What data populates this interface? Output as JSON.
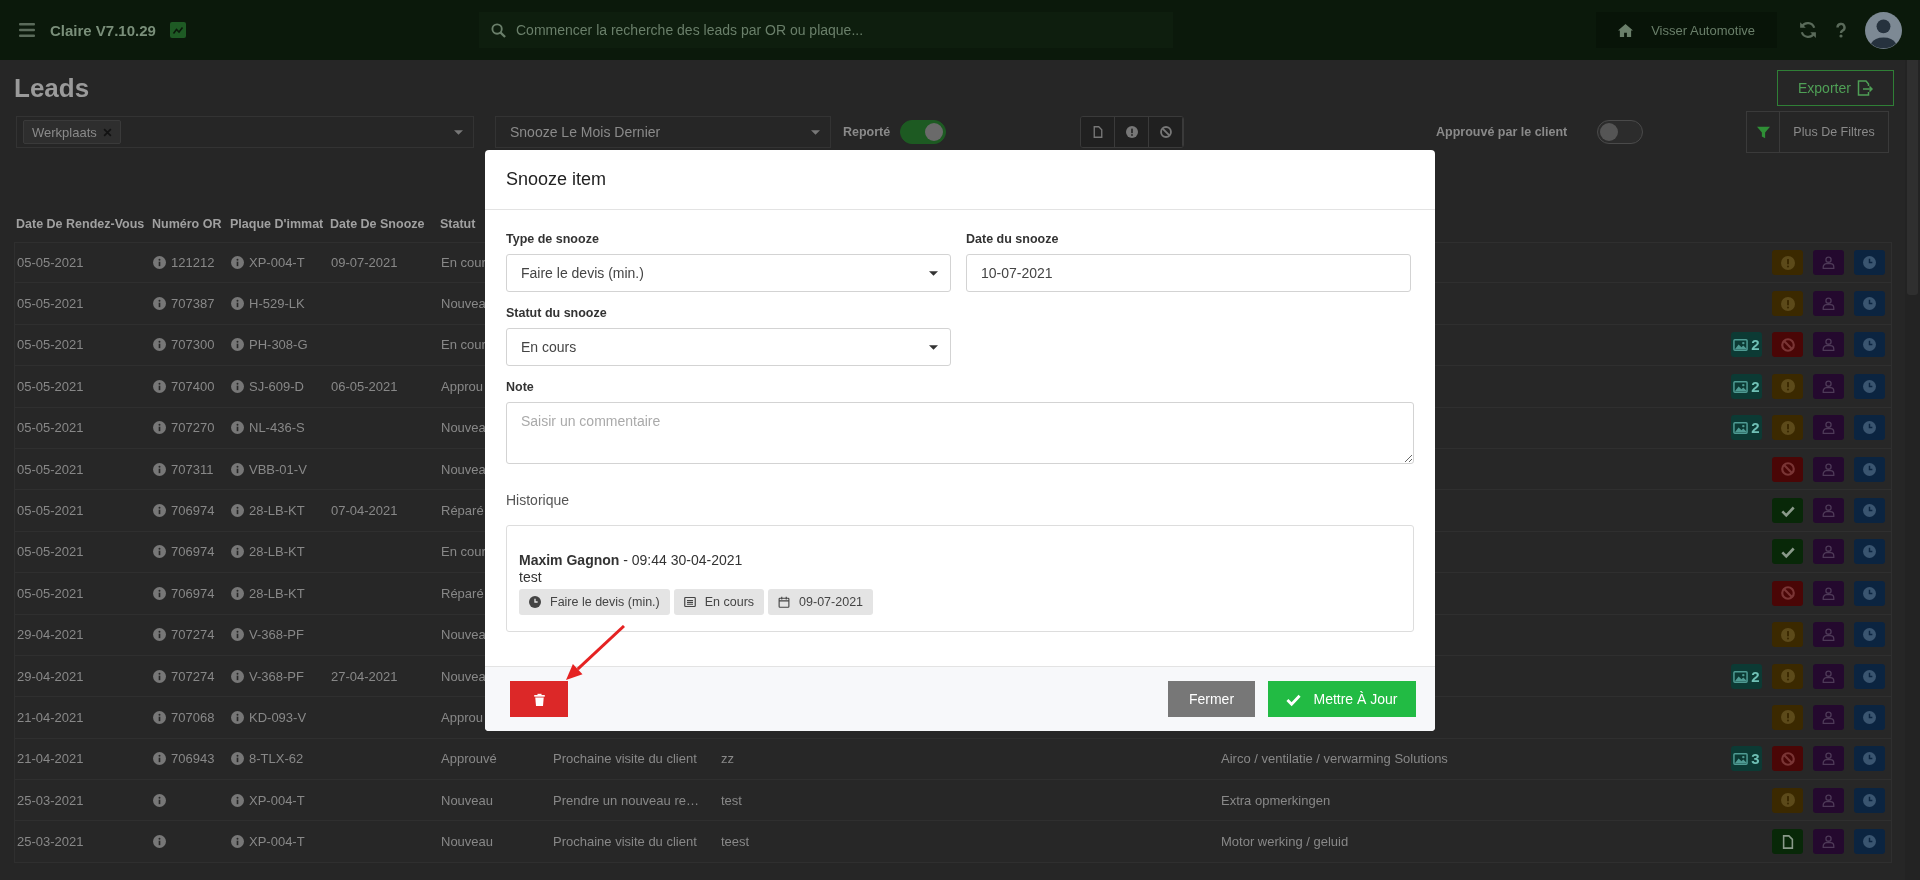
{
  "topbar": {
    "app_name": "Claire V7.10.29",
    "search": {
      "placeholder": "Commencer la recherche des leads par OR ou plaque..."
    },
    "garage_button": "Visser Automotive"
  },
  "page_title": "Leads",
  "export_button": "Exporter",
  "filters": {
    "tags": [
      {
        "label": "Werkplaats"
      }
    ],
    "period": "Snooze Le Mois Dernier",
    "reported": {
      "label": "Reporté",
      "on": true
    },
    "view_buttons": [
      {
        "kind": "document"
      },
      {
        "kind": "warning"
      },
      {
        "kind": "blocked"
      }
    ],
    "approved": {
      "label": "Approuvé par le client",
      "on": false
    },
    "more_filters": "Plus De Filtres"
  },
  "table": {
    "columns": [
      "Date De Rendez-Vous",
      "Numéro OR",
      "Plaque D'immat",
      "Date De Snooze",
      "Statut"
    ],
    "rows": [
      {
        "date": "05-05-2021",
        "or": "121212",
        "plate": "XP-004-T",
        "snooze_date": "09-07-2021",
        "status": "En cour",
        "badge": {
          "kind": "warning"
        }
      },
      {
        "date": "05-05-2021",
        "or": "707387",
        "plate": "H-529-LK",
        "status": "Nouvea",
        "badge": {
          "kind": "warning"
        }
      },
      {
        "date": "05-05-2021",
        "or": "707300",
        "plate": "PH-308-G",
        "status": "En cour",
        "photos": "2",
        "badge": {
          "kind": "blocked"
        }
      },
      {
        "date": "05-05-2021",
        "or": "707400",
        "plate": "SJ-609-D",
        "snooze_date": "06-05-2021",
        "status": "Approu",
        "photos": "2",
        "badge": {
          "kind": "warning"
        }
      },
      {
        "date": "05-05-2021",
        "or": "707270",
        "plate": "NL-436-S",
        "status": "Nouvea",
        "photos": "2",
        "badge": {
          "kind": "warning"
        }
      },
      {
        "date": "05-05-2021",
        "or": "707311",
        "plate": "VBB-01-V",
        "status": "Nouvea",
        "badge": {
          "kind": "blocked"
        }
      },
      {
        "date": "05-05-2021",
        "or": "706974",
        "plate": "28-LB-KT",
        "snooze_date": "07-04-2021",
        "status": "Réparé",
        "badge": {
          "kind": "done"
        }
      },
      {
        "date": "05-05-2021",
        "or": "706974",
        "plate": "28-LB-KT",
        "status": "En cour",
        "badge": {
          "kind": "done"
        }
      },
      {
        "date": "05-05-2021",
        "or": "706974",
        "plate": "28-LB-KT",
        "status": "Réparé",
        "badge": {
          "kind": "blocked"
        }
      },
      {
        "date": "29-04-2021",
        "or": "707274",
        "plate": "V-368-PF",
        "status": "Nouvea",
        "badge": {
          "kind": "warning"
        }
      },
      {
        "date": "29-04-2021",
        "or": "707274",
        "plate": "V-368-PF",
        "snooze_date": "27-04-2021",
        "status": "Nouvea",
        "photos": "2",
        "badge": {
          "kind": "warning"
        }
      },
      {
        "date": "21-04-2021",
        "or": "707068",
        "plate": "KD-093-V",
        "status": "Approu",
        "badge": {
          "kind": "warning"
        }
      },
      {
        "date": "21-04-2021",
        "or": "706943",
        "plate": "8-TLX-62",
        "status": "Approuvé",
        "column_6": "Prochaine visite du client",
        "column_7": "zz",
        "column_8": "Airco / ventilatie / verwarming Solutions",
        "photos": "3",
        "badge": {
          "kind": "blocked"
        }
      },
      {
        "date": "25-03-2021",
        "plate": "XP-004-T",
        "status": "Nouveau",
        "column_6": "Prendre un nouveau re…",
        "column_7": "test",
        "column_8": "Extra opmerkingen",
        "badge": {
          "kind": "warning"
        }
      },
      {
        "date": "25-03-2021",
        "plate": "XP-004-T",
        "status": "Nouveau",
        "column_6": "Prochaine visite du client",
        "column_7": "teest",
        "column_8": "Motor werking / geluid",
        "badge": {
          "kind": "document"
        }
      }
    ]
  },
  "snooze_modal": {
    "title": "Snooze item",
    "type": {
      "label": "Type de snooze",
      "value": "Faire le devis (min.)"
    },
    "date": {
      "label": "Date du snooze",
      "value": "10-07-2021"
    },
    "status": {
      "label": "Statut du snooze",
      "value": "En cours"
    },
    "note": {
      "label": "Note",
      "placeholder": "Saisir un commentaire"
    },
    "history_label": "Historique",
    "history": [
      {
        "line": "**Maxim Gagnon** - 09:44 30-04-2021",
        "text": "test",
        "tags": [
          {
            "kind": "type",
            "label": "Faire le devis (min.)"
          },
          {
            "kind": "status",
            "label": "En cours"
          },
          {
            "kind": "date",
            "label": "09-07-2021"
          }
        ]
      }
    ],
    "close_button": "Fermer",
    "update_button": "Mettre À Jour"
  }
}
